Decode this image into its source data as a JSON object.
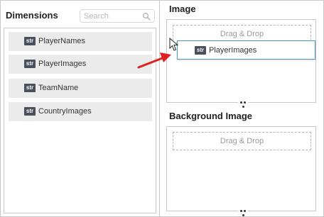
{
  "dimensions_panel": {
    "title": "Dimensions",
    "search_placeholder": "Search",
    "items": [
      {
        "badge": "str",
        "label": "PlayerNames"
      },
      {
        "badge": "str",
        "label": "PlayerImages"
      },
      {
        "badge": "str",
        "label": "TeamName"
      },
      {
        "badge": "str",
        "label": "CountryImages"
      }
    ]
  },
  "image_section": {
    "title": "Image",
    "drop_text": "Drag & Drop"
  },
  "background_section": {
    "title": "Background Image",
    "drop_text": "Drag & Drop"
  },
  "drag_ghost": {
    "badge": "str",
    "label": "PlayerImages"
  },
  "icons": {
    "search": "search-icon",
    "pointer": "mouse-pointer-icon",
    "arrow": "red-arrow-icon",
    "more": "more-dots-icon"
  },
  "colors": {
    "badge_bg": "#4a4f5c",
    "item_bg": "#ebebeb",
    "ghost_border": "#4a9bc9",
    "arrow": "#e02020"
  }
}
